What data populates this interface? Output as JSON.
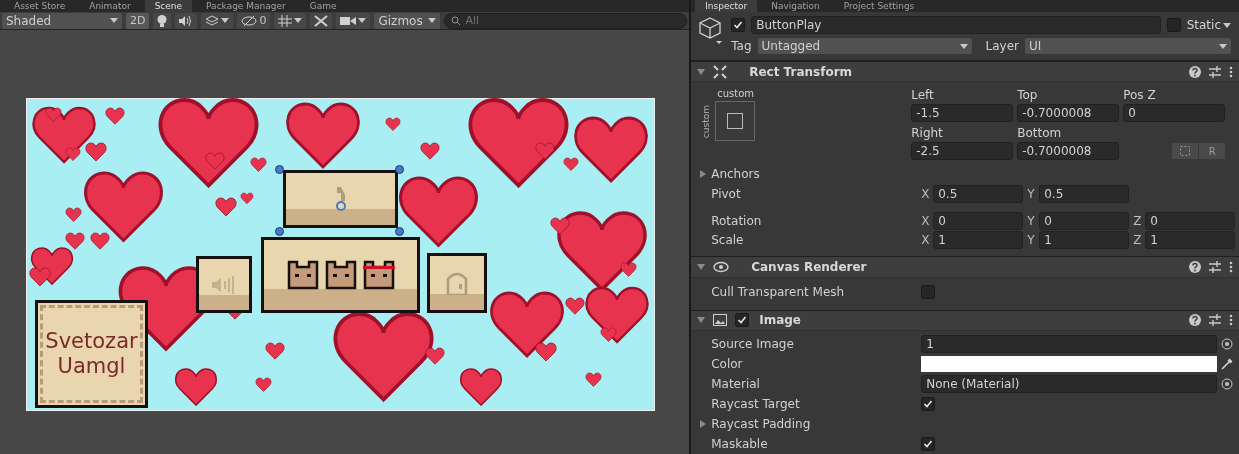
{
  "editor_tabs": [
    {
      "label": "Asset Store",
      "selected": false
    },
    {
      "label": "Animator",
      "selected": false
    },
    {
      "label": "Scene",
      "selected": true
    },
    {
      "label": "Package Manager",
      "selected": false
    },
    {
      "label": "Game",
      "selected": false
    }
  ],
  "inspector_tabs": [
    {
      "label": "Inspector",
      "selected": true
    },
    {
      "label": "Navigation",
      "selected": false
    },
    {
      "label": "Project Settings",
      "selected": false
    }
  ],
  "scene_toolbar": {
    "shading_mode": "Shaded",
    "mode_2d": {
      "label": "2D",
      "on": true
    },
    "hidden_count": "0",
    "gizmos": "Gizmos",
    "search": {
      "placeholder": "All"
    }
  },
  "scene": {
    "name_card": [
      "Svetozar",
      "Uamgl"
    ]
  },
  "object": {
    "active": true,
    "name": "ButtonPlay",
    "static": false,
    "static_label": "Static",
    "tag_label": "Tag",
    "tag": "Untagged",
    "layer_label": "Layer",
    "layer": "UI"
  },
  "rect_transform": {
    "title": "Rect Transform",
    "expanded": true,
    "anchor_preset": "custom",
    "anchor_preset_side": "custom",
    "raw_edit_label": "R",
    "fields": [
      {
        "label": "Left",
        "value": "-1.5"
      },
      {
        "label": "Top",
        "value": "-0.7000008"
      },
      {
        "label": "Pos Z",
        "value": "0"
      },
      {
        "label": "Right",
        "value": "-2.5"
      },
      {
        "label": "Bottom",
        "value": "-0.7000008"
      }
    ],
    "anchors": {
      "label": "Anchors",
      "expanded": false
    },
    "vectors": [
      {
        "label": "Pivot",
        "components": [
          {
            "axis": "X",
            "value": "0.5"
          },
          {
            "axis": "Y",
            "value": "0.5"
          }
        ]
      },
      {
        "label": "Rotation",
        "components": [
          {
            "axis": "X",
            "value": "0"
          },
          {
            "axis": "Y",
            "value": "0"
          },
          {
            "axis": "Z",
            "value": "0"
          }
        ]
      },
      {
        "label": "Scale",
        "components": [
          {
            "axis": "X",
            "value": "1"
          },
          {
            "axis": "Y",
            "value": "1"
          },
          {
            "axis": "Z",
            "value": "1"
          }
        ]
      }
    ]
  },
  "canvas_renderer": {
    "title": "Canvas Renderer",
    "expanded": true,
    "rows": [
      {
        "kind": "checkbox",
        "label": "Cull Transparent Mesh",
        "checked": false
      }
    ]
  },
  "image": {
    "title": "Image",
    "expanded": true,
    "enabled": true,
    "rows": [
      {
        "kind": "object",
        "label": "Source Image",
        "value": "1"
      },
      {
        "kind": "color",
        "label": "Color",
        "color": "#ffffff"
      },
      {
        "kind": "object",
        "label": "Material",
        "value": "None (Material)"
      },
      {
        "kind": "checkbox",
        "label": "Raycast Target",
        "checked": true
      },
      {
        "kind": "foldout",
        "label": "Raycast Padding",
        "expanded": false
      },
      {
        "kind": "checkbox",
        "label": "Maskable",
        "checked": true
      }
    ]
  }
}
